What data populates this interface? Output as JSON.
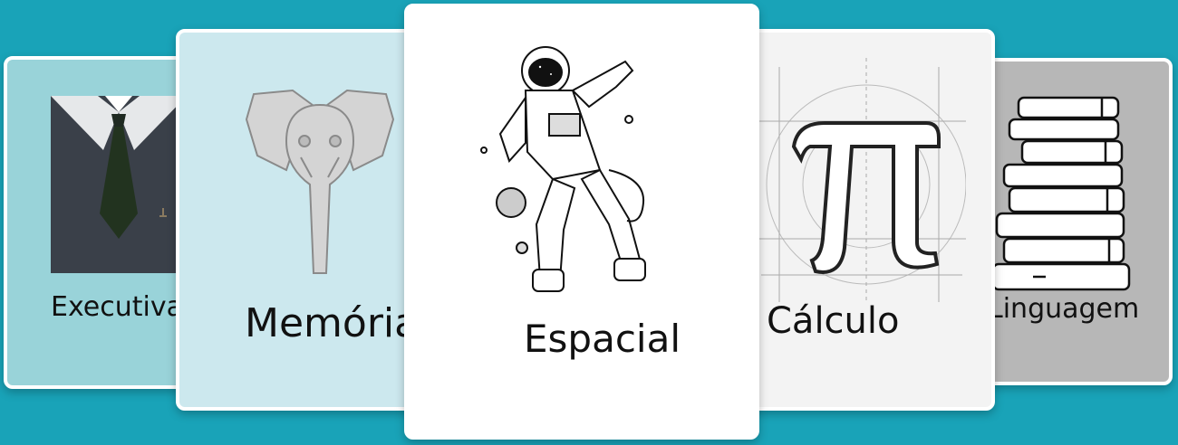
{
  "carousel": {
    "cards": [
      {
        "label": "Executiva",
        "icon": "suit-tie-icon",
        "background": "#99d3d9"
      },
      {
        "label": "Memória",
        "icon": "elephant-icon",
        "background": "#cce8ee"
      },
      {
        "label": "Espacial",
        "icon": "astronaut-icon",
        "background": "#ffffff"
      },
      {
        "label": "Cálculo",
        "icon": "pi-icon",
        "background": "#f3f3f3"
      },
      {
        "label": "Linguagem",
        "icon": "books-icon",
        "background": "#b7b7b7"
      }
    ]
  },
  "colors": {
    "page_background": "#19a3b8",
    "card_border": "#ffffff"
  }
}
